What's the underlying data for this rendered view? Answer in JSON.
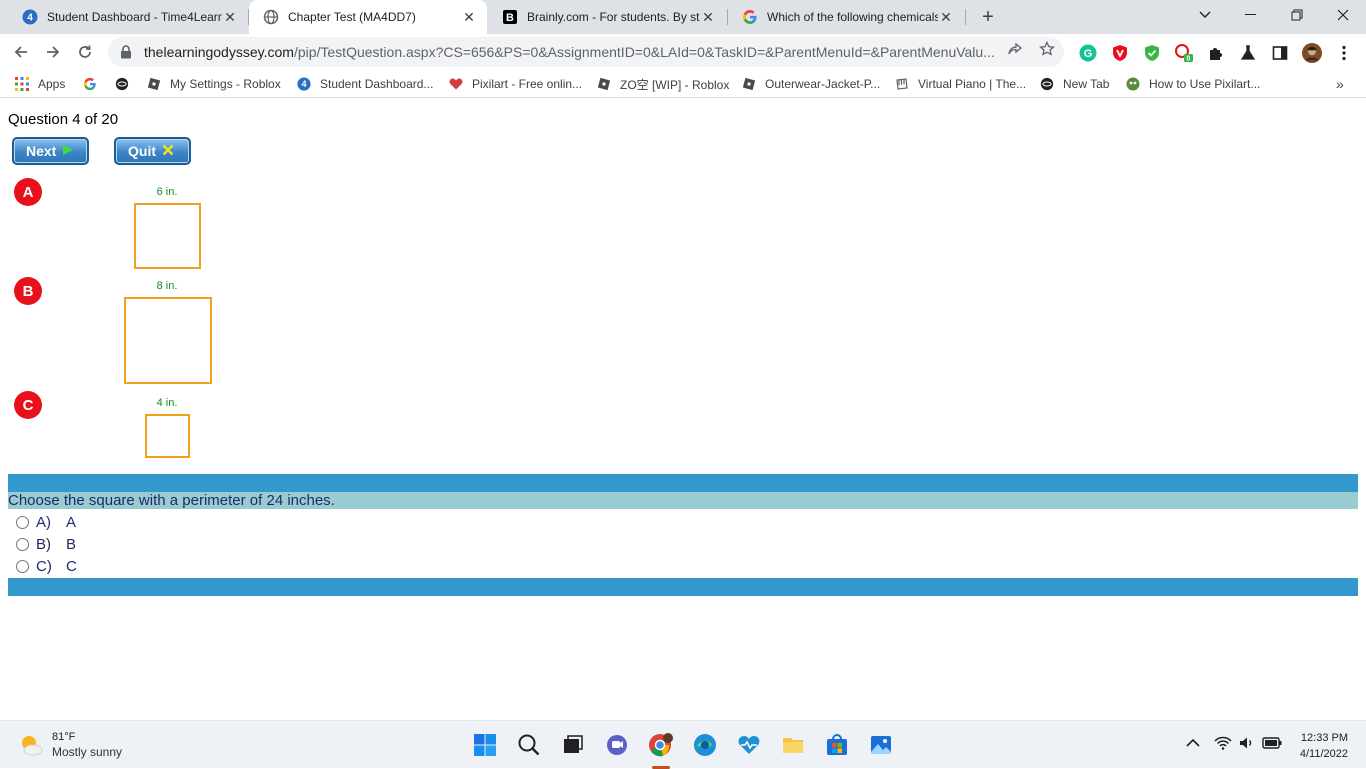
{
  "browser": {
    "tabs": [
      {
        "title": "Student Dashboard - Time4Learn",
        "active": false
      },
      {
        "title": "Chapter Test (MA4DD7)",
        "active": true
      },
      {
        "title": "Brainly.com - For students. By stu",
        "active": false
      },
      {
        "title": "Which of the following chemicals",
        "active": false
      }
    ],
    "url_host": "thelearningodyssey.com",
    "url_path": "/pip/TestQuestion.aspx?CS=656&PS=0&AssignmentID=0&LAId=0&TaskID=&ParentMenuId=&ParentMenuValu...",
    "extension_badge": "0",
    "bookmarks": [
      {
        "label": "Apps",
        "icon": "apps-grid-icon"
      },
      {
        "label": "",
        "icon": "google-icon"
      },
      {
        "label": "",
        "icon": "globe-icon"
      },
      {
        "label": "My Settings - Roblox",
        "icon": "roblox-icon"
      },
      {
        "label": "Student Dashboard...",
        "icon": "time4learning-icon"
      },
      {
        "label": "Pixilart - Free onlin...",
        "icon": "pixilart-heart-icon"
      },
      {
        "label": "ZO空 [WIP] - Roblox",
        "icon": "roblox-icon"
      },
      {
        "label": "Outerwear-Jacket-P...",
        "icon": "roblox-icon"
      },
      {
        "label": "Virtual Piano | The...",
        "icon": "piano-icon"
      },
      {
        "label": "New Tab",
        "icon": "globe-icon"
      },
      {
        "label": "How to Use Pixilart...",
        "icon": "pixilart-icon"
      }
    ]
  },
  "page": {
    "question_number": "Question 4 of 20",
    "next_label": "Next",
    "quit_label": "Quit",
    "figures": [
      {
        "letter": "A",
        "side_label": "6 in."
      },
      {
        "letter": "B",
        "side_label": "8 in."
      },
      {
        "letter": "C",
        "side_label": "4 in."
      }
    ],
    "prompt": "Choose the square with a perimeter of 24 inches.",
    "choices": [
      {
        "key": "A)",
        "text": "A"
      },
      {
        "key": "B)",
        "text": "B"
      },
      {
        "key": "C)",
        "text": "C"
      }
    ]
  },
  "taskbar": {
    "temperature": "81°F",
    "condition": "Mostly sunny",
    "time": "12:33 PM",
    "date": "4/11/2022"
  },
  "colors": {
    "badge_red": "#e8101b",
    "square_orange": "#f0a01e",
    "label_green": "#138a1d",
    "bar_blue": "#3399cc",
    "bar_teal": "#99ccd1",
    "prompt_navy": "#1f2a6b"
  }
}
